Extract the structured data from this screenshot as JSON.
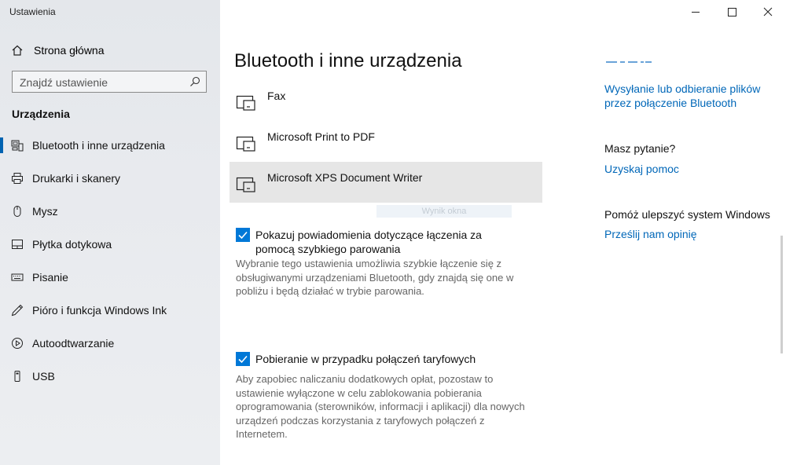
{
  "window": {
    "title": "Ustawienia"
  },
  "sidebar": {
    "home_label": "Strona główna",
    "search_placeholder": "Znajdź ustawienie",
    "section_title": "Urządzenia",
    "items": [
      {
        "label": "Bluetooth i inne urządzenia",
        "icon": "bluetooth-devices-icon",
        "active": true
      },
      {
        "label": "Drukarki i skanery",
        "icon": "printer-icon"
      },
      {
        "label": "Mysz",
        "icon": "mouse-icon"
      },
      {
        "label": "Płytka dotykowa",
        "icon": "touchpad-icon"
      },
      {
        "label": "Pisanie",
        "icon": "keyboard-icon"
      },
      {
        "label": "Pióro i funkcja Windows Ink",
        "icon": "pen-icon"
      },
      {
        "label": "Autoodtwarzanie",
        "icon": "autoplay-icon"
      },
      {
        "label": "USB",
        "icon": "usb-icon"
      }
    ]
  },
  "main": {
    "title": "Bluetooth i inne urządzenia",
    "devices": [
      {
        "label": "Fax",
        "icon": "printer-device-icon"
      },
      {
        "label": "Microsoft Print to PDF",
        "icon": "printer-device-icon"
      },
      {
        "label": "Microsoft XPS Document Writer",
        "icon": "printer-device-icon",
        "selected": true
      }
    ],
    "ghost_tooltip": "Wynik okna",
    "swift_pair": {
      "checked": true,
      "label": "Pokazuj powiadomienia dotyczące łączenia za pomocą szybkiego parowania",
      "description": "Wybranie tego ustawienia umożliwia szybkie łączenie się z obsługiwanymi urządzeniami Bluetooth, gdy znajdą się one w pobliżu i będą działać w trybie parowania."
    },
    "metered": {
      "checked": true,
      "label": "Pobieranie w przypadku połączeń taryfowych",
      "description": "Aby zapobiec naliczaniu dodatkowych opłat, pozostaw to ustawienie wyłączone w celu zablokowania pobierania oprogramowania (sterowników, informacji i aplikacji) dla nowych urządzeń podczas korzystania z taryfowych połączeń z Internetem."
    }
  },
  "related": {
    "link_send_receive": "Wysyłanie lub odbieranie plików przez połączenie Bluetooth",
    "question_heading": "Masz pytanie?",
    "help_link": "Uzyskaj pomoc",
    "improve_heading": "Pomóż ulepszyć system Windows",
    "feedback_link": "Prześlij nam opinię"
  },
  "colors": {
    "accent": "#0078d7",
    "link": "#0067b8",
    "sidebar_bg": "#e6e9ed"
  }
}
